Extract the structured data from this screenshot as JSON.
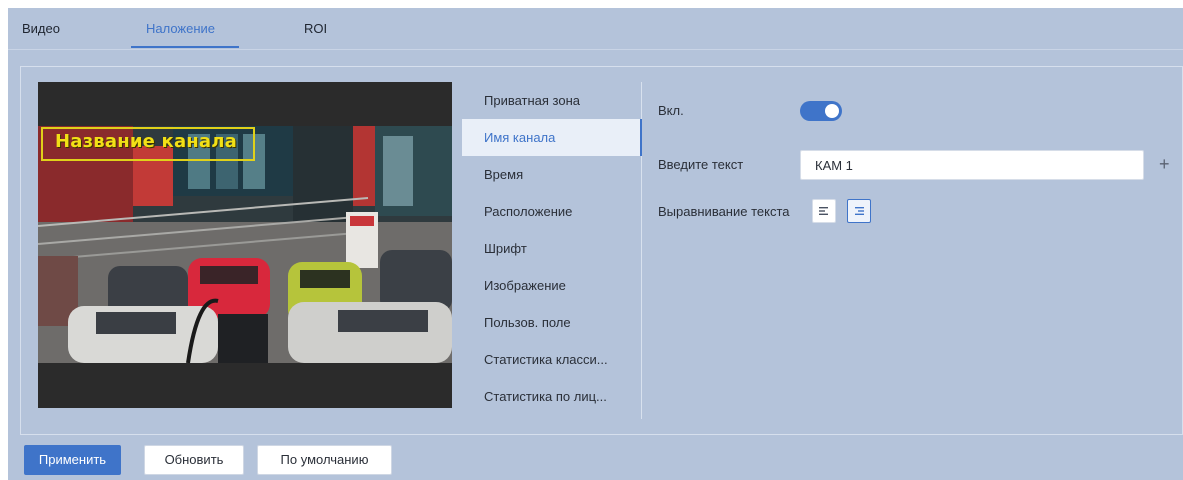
{
  "tabs": [
    {
      "label": "Видео",
      "active": false
    },
    {
      "label": "Наложение",
      "active": true
    },
    {
      "label": "ROI",
      "active": false
    }
  ],
  "preview": {
    "osd_text": "Название канала"
  },
  "menu": {
    "items": [
      {
        "label": "Приватная зона",
        "active": false
      },
      {
        "label": "Имя канала",
        "active": true
      },
      {
        "label": "Время",
        "active": false
      },
      {
        "label": "Расположение",
        "active": false
      },
      {
        "label": "Шрифт",
        "active": false
      },
      {
        "label": "Изображение",
        "active": false
      },
      {
        "label": "Пользов. поле",
        "active": false
      },
      {
        "label": "Статистика класси...",
        "active": false
      },
      {
        "label": "Статистика по лиц...",
        "active": false
      }
    ]
  },
  "form": {
    "enable_label": "Вкл.",
    "enable_value": true,
    "text_label": "Введите текст",
    "text_value": "КАМ 1",
    "align_label": "Выравнивание текста",
    "align_selected": "right",
    "add_icon": "plus-icon"
  },
  "footer": {
    "apply_label": "Применить",
    "refresh_label": "Обновить",
    "default_label": "По умолчанию"
  },
  "colors": {
    "accent": "#3f74c9",
    "background": "#b4c3da",
    "osd": "#f2e016"
  }
}
